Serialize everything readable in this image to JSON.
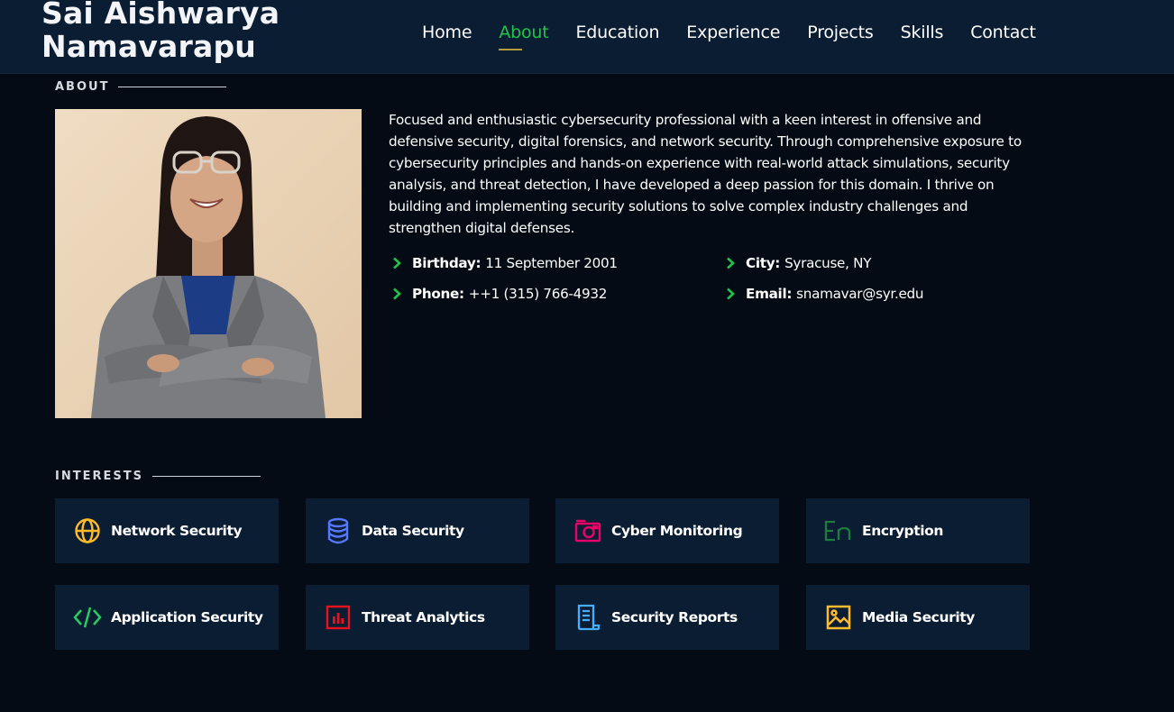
{
  "header": {
    "logo_line1": "Sai Aishwarya",
    "logo_line2": "Namavarapu",
    "nav": [
      "Home",
      "About",
      "Education",
      "Experience",
      "Projects",
      "Skills",
      "Contact"
    ],
    "active_nav": "About",
    "active_color": "#1fc34a"
  },
  "about": {
    "title": "ABOUT",
    "description": "Focused and enthusiastic cybersecurity professional with a keen interest in offensive and defensive security, digital forensics, and network security. Through comprehensive exposure to cybersecurity principles and hands-on experience with real-world attack simulations, security analysis, and threat detection, I have developed a deep passion for this domain. I thrive on building and implementing security solutions to solve complex industry challenges and strengthen digital defenses.",
    "info": [
      {
        "key": "Birthday:",
        "value": "11 September 2001"
      },
      {
        "key": "City:",
        "value": "Syracuse, NY"
      },
      {
        "key": "Phone:",
        "value": "++1 (315) 766-4932"
      },
      {
        "key": "Email:",
        "value": "snamavar@syr.edu"
      }
    ]
  },
  "interests": {
    "title": "INTERESTS",
    "items": [
      {
        "label": "Network Security",
        "icon": "globe-icon",
        "color": "#ffbb2c"
      },
      {
        "label": "Data Security",
        "icon": "database-icon",
        "color": "#5578ff"
      },
      {
        "label": "Cyber Monitoring",
        "icon": "camera-icon",
        "color": "#e80368"
      },
      {
        "label": "Encryption",
        "icon": "translate-icon",
        "color": "#1c7c3c"
      },
      {
        "label": "Application Security",
        "icon": "code-icon",
        "color": "#29cc61"
      },
      {
        "label": "Threat Analytics",
        "icon": "chart-bars-icon",
        "color": "#e8111f"
      },
      {
        "label": "Security Reports",
        "icon": "document-icon",
        "color": "#47aeff"
      },
      {
        "label": "Media Security",
        "icon": "image-icon",
        "color": "#ffa76e"
      }
    ]
  }
}
